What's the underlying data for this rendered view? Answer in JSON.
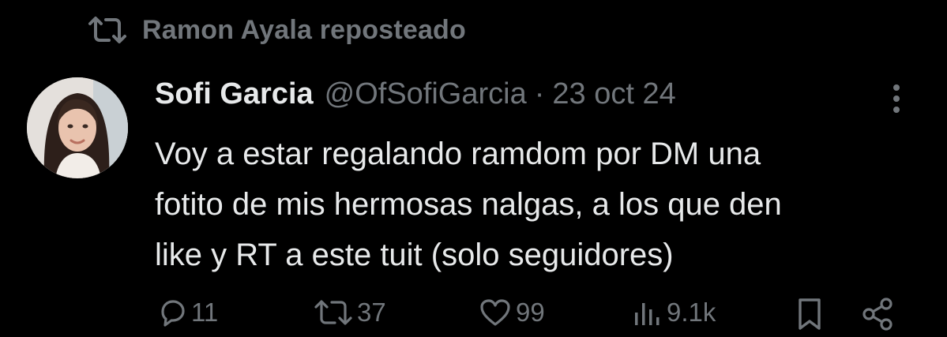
{
  "repost": {
    "icon": "repost-icon",
    "text": "Ramon Ayala reposteado"
  },
  "tweet": {
    "author_name": "Sofi Garcia",
    "handle": "@OfSofiGarcia",
    "separator": "·",
    "date": "23 oct 24",
    "text_lines": [
      "Voy a estar regalando ramdom por DM una",
      "fotito de mis hermosas nalgas, a los que den",
      "like y RT a este tuit (solo seguidores)"
    ]
  },
  "actions": {
    "replies": "11",
    "retweets": "37",
    "likes": "99",
    "views": "9.1k"
  },
  "colors": {
    "background": "#000000",
    "primary_text": "#e7e9ea",
    "secondary_text": "#71767b"
  }
}
